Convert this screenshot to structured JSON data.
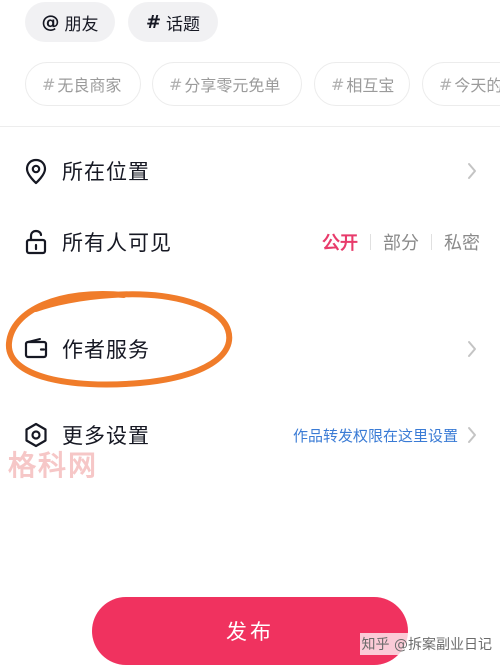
{
  "mention_chips": {
    "friends": {
      "symbol": "@",
      "label": "朋友"
    },
    "topic": {
      "symbol": "#",
      "label": "话题"
    }
  },
  "suggested_tags": [
    {
      "hash": "#",
      "label": "无良商家"
    },
    {
      "hash": "#",
      "label": "分享零元免单"
    },
    {
      "hash": "#",
      "label": "相互宝"
    },
    {
      "hash": "#",
      "label": "今天的"
    }
  ],
  "settings": {
    "location": {
      "label": "所在位置",
      "icon": "location-pin-icon"
    },
    "visibility": {
      "label": "所有人可见",
      "icon": "unlock-icon",
      "options": [
        "公开",
        "部分",
        "私密"
      ],
      "selected": "公开"
    },
    "author_service": {
      "label": "作者服务",
      "icon": "wallet-icon",
      "highlight_color": "#f07c2a"
    },
    "more_settings": {
      "label": "更多设置",
      "icon": "settings-hexagon-icon",
      "hint": "作品转发权限在这里设置"
    }
  },
  "publish_button": {
    "label": "发布",
    "color": "#f0325f"
  },
  "watermarks": {
    "left": "格科网",
    "right": "知乎 @拆案副业日记"
  },
  "colors": {
    "accent": "#e83b6b",
    "link": "#3a7bd5"
  }
}
